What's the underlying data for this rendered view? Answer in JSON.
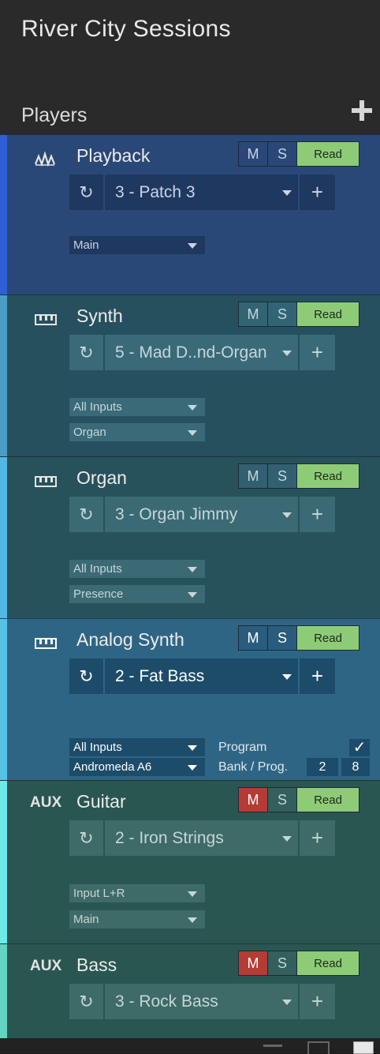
{
  "app_title": "River City Sessions",
  "section": {
    "title": "Players"
  },
  "players": [
    {
      "name": "Playback",
      "type_label": "",
      "icon": "waveform-icon",
      "patch": "3 - Patch 3",
      "inputs": [
        "Main"
      ],
      "mute_active": false,
      "colors": {
        "bg": "#2a4877",
        "strip": "#2f5fd4",
        "ctrl": "#1f3860",
        "btn": "#2a4777",
        "text": "#c9d4e6"
      }
    },
    {
      "name": "Synth",
      "type_label": "",
      "icon": "keyboard-icon",
      "patch": "5 - Mad D..nd-Organ",
      "inputs": [
        "All Inputs",
        "Organ"
      ],
      "mute_active": false,
      "colors": {
        "bg": "#27505e",
        "strip": "#4a9ec6",
        "ctrl": "#3a6a78",
        "btn": "#336474",
        "text": "#c5d7dc"
      }
    },
    {
      "name": "Organ",
      "type_label": "",
      "icon": "keyboard-icon",
      "patch": "3 - Organ Jimmy",
      "inputs": [
        "All Inputs",
        "Presence"
      ],
      "mute_active": false,
      "colors": {
        "bg": "#27525c",
        "strip": "#52b7e2",
        "ctrl": "#3b6a74",
        "btn": "#336070",
        "text": "#c5d7dc"
      }
    },
    {
      "name": "Analog Synth",
      "type_label": "",
      "icon": "keyboard-icon",
      "patch": "2 - Fat Bass",
      "inputs": [
        "All Inputs",
        "Andromeda A6"
      ],
      "mute_active": false,
      "program": {
        "label": "Program",
        "checked": true,
        "bank_label": "Bank / Prog.",
        "bank": "2",
        "prog": "8"
      },
      "colors": {
        "bg": "#2f6584",
        "strip": "#56c3e6",
        "ctrl": "#1c4c6a",
        "btn": "#2a5d7d",
        "text": "#ffffff"
      }
    },
    {
      "name": "Guitar",
      "type_label": "AUX",
      "icon": "",
      "patch": "2 - Iron Strings",
      "inputs": [
        "Input L+R",
        "Main"
      ],
      "mute_active": true,
      "colors": {
        "bg": "#2a5652",
        "strip": "#6ee9e9",
        "ctrl": "#3e6b67",
        "btn": "#33605c",
        "text": "#c5d7d5"
      }
    },
    {
      "name": "Bass",
      "type_label": "AUX",
      "icon": "",
      "patch": "3 - Rock Bass",
      "inputs": [],
      "mute_active": true,
      "colors": {
        "bg": "#2a5652",
        "strip": "#62d4c1",
        "ctrl": "#3e6b67",
        "btn": "#33605c",
        "text": "#c5d7d5"
      }
    }
  ],
  "buttons": {
    "mute": "M",
    "solo": "S",
    "automation": "Read"
  },
  "colors": {
    "read_green": "#8ecb77",
    "mute_red": "#b53b35"
  }
}
